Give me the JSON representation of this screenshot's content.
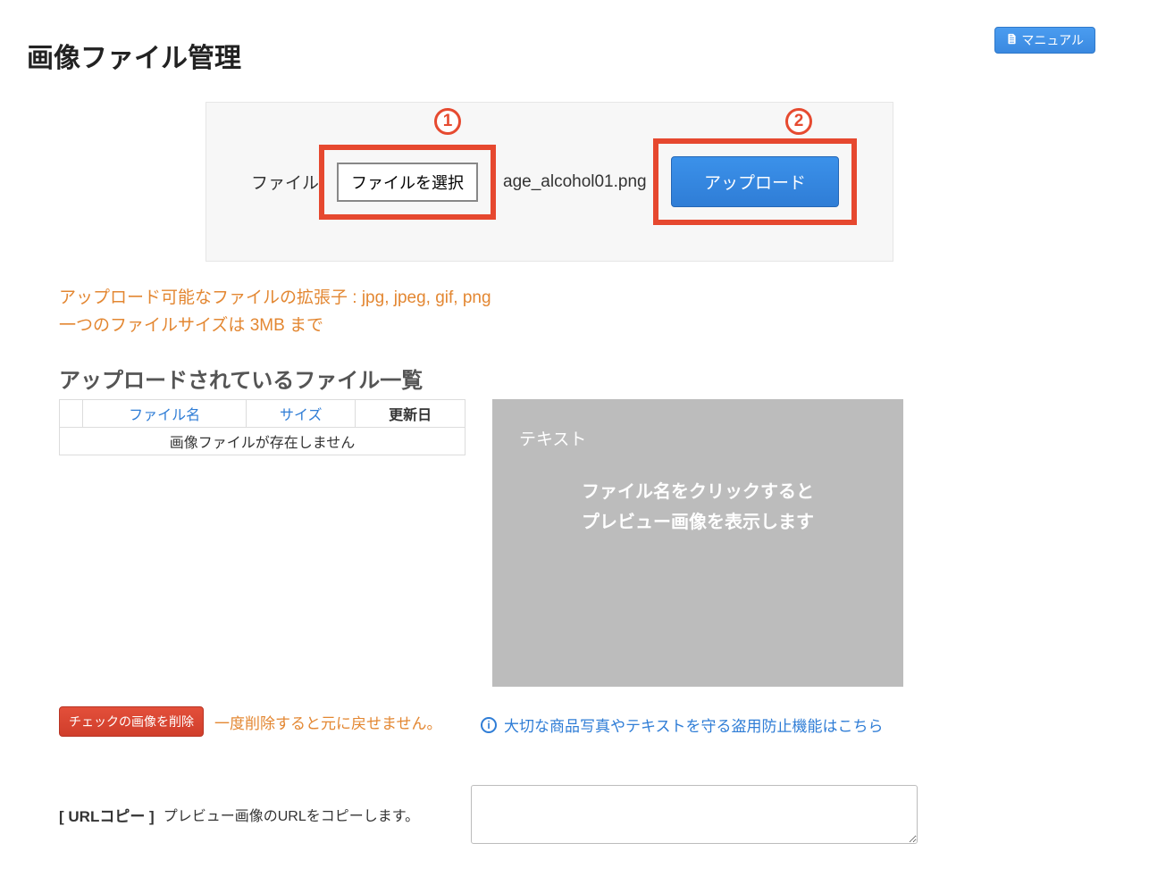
{
  "header": {
    "page_title": "画像ファイル管理",
    "manual_button": "マニュアル"
  },
  "upload": {
    "annotation1": "1",
    "annotation2": "2",
    "label": "ファイル",
    "choose_button": "ファイルを選択",
    "selected_filename": "age_alcohol01.png",
    "upload_button": "アップロード"
  },
  "info": {
    "line1": "アップロード可能なファイルの拡張子 : jpg, jpeg, gif, png",
    "line2": "一つのファイルサイズは 3MB まで"
  },
  "list": {
    "section_title": "アップロードされているファイル一覧",
    "columns": {
      "filename": "ファイル名",
      "size": "サイズ",
      "updated": "更新日"
    },
    "empty_message": "画像ファイルが存在しません"
  },
  "preview": {
    "label": "テキスト",
    "message_line1": "ファイル名をクリックすると",
    "message_line2": "プレビュー画像を表示します"
  },
  "delete": {
    "button": "チェックの画像を削除",
    "warning": "一度削除すると元に戻せません。"
  },
  "theft_protection": {
    "link_text": "大切な商品写真やテキストを守る盗用防止機能はこちら"
  },
  "urlcopy": {
    "label": "[ URLコピー ]",
    "description": "プレビュー画像のURLをコピーします。",
    "value": ""
  }
}
